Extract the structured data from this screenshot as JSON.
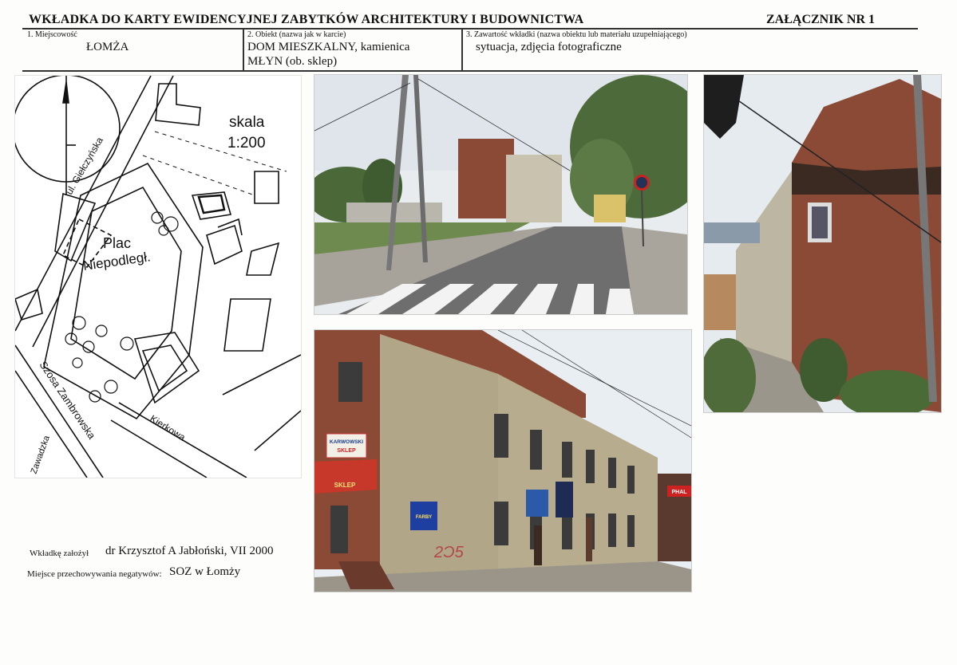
{
  "header": {
    "title": "WKŁADKA DO KARTY EWIDENCYJNEJ ZABYTKÓW ARCHITEKTURY I BUDOWNICTWA",
    "annex": "ZAŁĄCZNIK NR 1"
  },
  "fields": {
    "locality_label": "1. Miejscowość",
    "locality_value": "ŁOMŻA",
    "object_label": "2. Obiekt  (nazwa jak w karcie)",
    "object_value_line1": "DOM MIESZKALNY,  kamienica",
    "object_value_line2": "MŁYN   (ob. sklep)",
    "contents_label": "3. Zawartość wkładki  (nazwa obiektu lub materiału uzupełniającego)",
    "contents_value": "sytuacja,  zdjęcia fotograficzne"
  },
  "map": {
    "scale_label": "skala",
    "scale_value": "1:200",
    "square_line1": "Plac",
    "square_line2": "Niepodległ.",
    "street_1": "ul. Giełczyńska",
    "street_2": "Szosa Zambrowska",
    "street_3": "Kierkowa",
    "street_4": "Zawadzka"
  },
  "signs": {
    "shop_line1": "KARWOWSKI",
    "shop_line2": "SKLEP",
    "awning": "SKLEP",
    "paint_sign": "FARBY",
    "advert": "PHAL"
  },
  "footer": {
    "founded_label": "Wkładkę założył",
    "founded_value": "dr Krzysztof A Jabłoński,  VII 2000",
    "storage_label": "Miejsce przechowywania negatywów:",
    "storage_value": "SOZ w Łomży"
  },
  "colors": {
    "brick": "#8a4a35",
    "plaster": "#b7ad8e",
    "sky": "#e9eef2",
    "road": "#6e6e6e",
    "foliage": "#4f6b3a"
  }
}
